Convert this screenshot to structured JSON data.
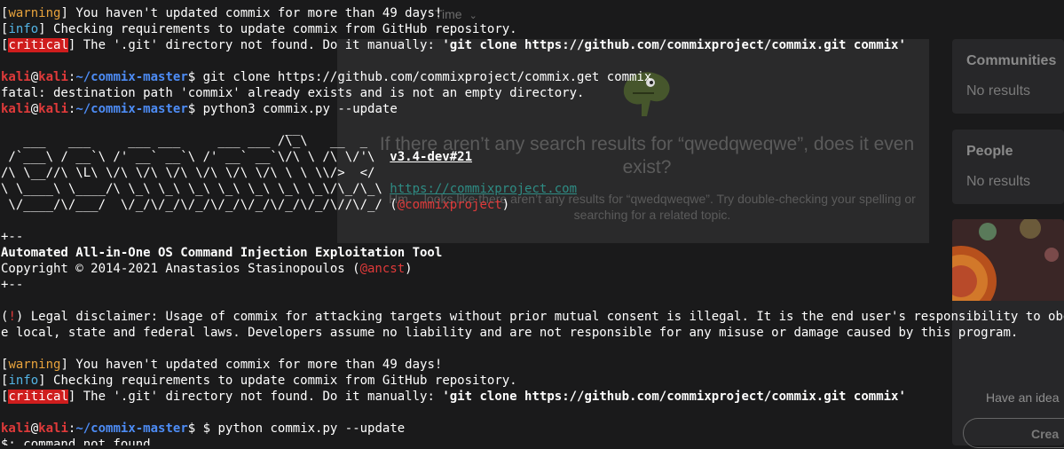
{
  "background": {
    "time_filter_label": "Time",
    "empty_heading": "If there aren’t any search results for “qwedqweqwe”, does it even exist?",
    "empty_subtext": "Hm… looks like there aren’t any results for “qwedqweqwe”. Try double-checking your spelling or searching for a related topic.",
    "communities_title": "Communities",
    "communities_text": "No results",
    "people_title": "People",
    "people_text": "No results",
    "idea_text": "Have an idea",
    "create_label": "Crea"
  },
  "terminal": {
    "l1_open": "[",
    "l1_tag": "warning",
    "l1_close": "]",
    "l1_msg": " You haven't updated commix for more than 49 days!",
    "l2_open": "[",
    "l2_tag": "info",
    "l2_close": "]",
    "l2_msg": " Checking requirements to update commix from GitHub repository.",
    "l3_open": "[",
    "l3_tag": "critical",
    "l3_close": "]",
    "l3_msg": " The '.git' directory not found. Do it manually: ",
    "l3_cmd": "'git clone https://github.com/commixproject/commix.git commix'",
    "p1_user": "kali",
    "p1_at": "@",
    "p1_host": "kali",
    "p1_colon": ":",
    "p1_path": "~/commix-master",
    "p1_dollar": "$",
    "p1_cmd": " git clone https://github.com/commixproject/commix.get commix",
    "fatal": "fatal: destination path 'commix' already exists and is not an empty directory.",
    "p2_user": "kali",
    "p2_at": "@",
    "p2_host": "kali",
    "p2_colon": ":",
    "p2_path": "~/commix-master",
    "p2_dollar": "$",
    "p2_cmd": " python3 commix.py --update",
    "art1": "                                      __",
    "art2": "   ___   ___     ___ ___     ___ ___ /\\_\\   __  _",
    "art3": " /`___\\ / __`\\ /' __` __`\\ /' __` __`\\/\\ \\ /\\ \\/'\\  ",
    "art3_ver": "v3.4-dev#21",
    "art4": "/\\ \\__//\\ \\L\\ \\/\\ \\/\\ \\/\\ \\/\\ \\/\\ \\/\\ \\ \\ \\\\/>  </",
    "art5": "\\ \\____\\ \\____/\\ \\_\\ \\_\\ \\_\\ \\_\\ \\_\\ \\_\\ \\_\\/\\_/\\_\\ ",
    "art5_url": "https://commixproject.com",
    "art6": " \\/____/\\/___/  \\/_/\\/_/\\/_/\\/_/\\/_/\\/_/\\/_/\\//\\/_/ ",
    "art6_open": "(",
    "art6_handle": "@commixproject",
    "art6_close": ")",
    "sep1": "+--",
    "tool_title": "Automated All-in-One OS Command Injection Exploitation Tool",
    "copyright_pre": "Copyright © 2014-2021 Anastasios Stasinopoulos (",
    "copyright_handle": "@ancst",
    "copyright_post": ")",
    "sep2": "+--",
    "legal_open": "(",
    "legal_bang": "!",
    "legal_close": ")",
    "legal1": " Legal disclaimer: Usage of commix for attacking targets without prior mutual consent is illegal. It is the end user's responsibility to obey all applicabl",
    "legal2": "e local, state and federal laws. Developers assume no liability and are not responsible for any misuse or damage caused by this program.",
    "l4_open": "[",
    "l4_tag": "warning",
    "l4_close": "]",
    "l4_msg": " You haven't updated commix for more than 49 days!",
    "l5_open": "[",
    "l5_tag": "info",
    "l5_close": "]",
    "l5_msg": " Checking requirements to update commix from GitHub repository.",
    "l6_open": "[",
    "l6_tag": "critical",
    "l6_close": "]",
    "l6_msg": " The '.git' directory not found. Do it manually: ",
    "l6_cmd": "'git clone https://github.com/commixproject/commix.git commix'",
    "p3_user": "kali",
    "p3_at": "@",
    "p3_host": "kali",
    "p3_colon": ":",
    "p3_path": "~/commix-master",
    "p3_dollar": "$",
    "p3_cmd": " $ python commix.py --update",
    "last": "$: command not found"
  },
  "colors": {
    "warning": "#e8a33c",
    "info": "#54b5e6",
    "critical_bg": "#cf1d1d",
    "prompt": "#e03a3a",
    "path": "#4d8cf5",
    "link": "#2e8c84"
  }
}
